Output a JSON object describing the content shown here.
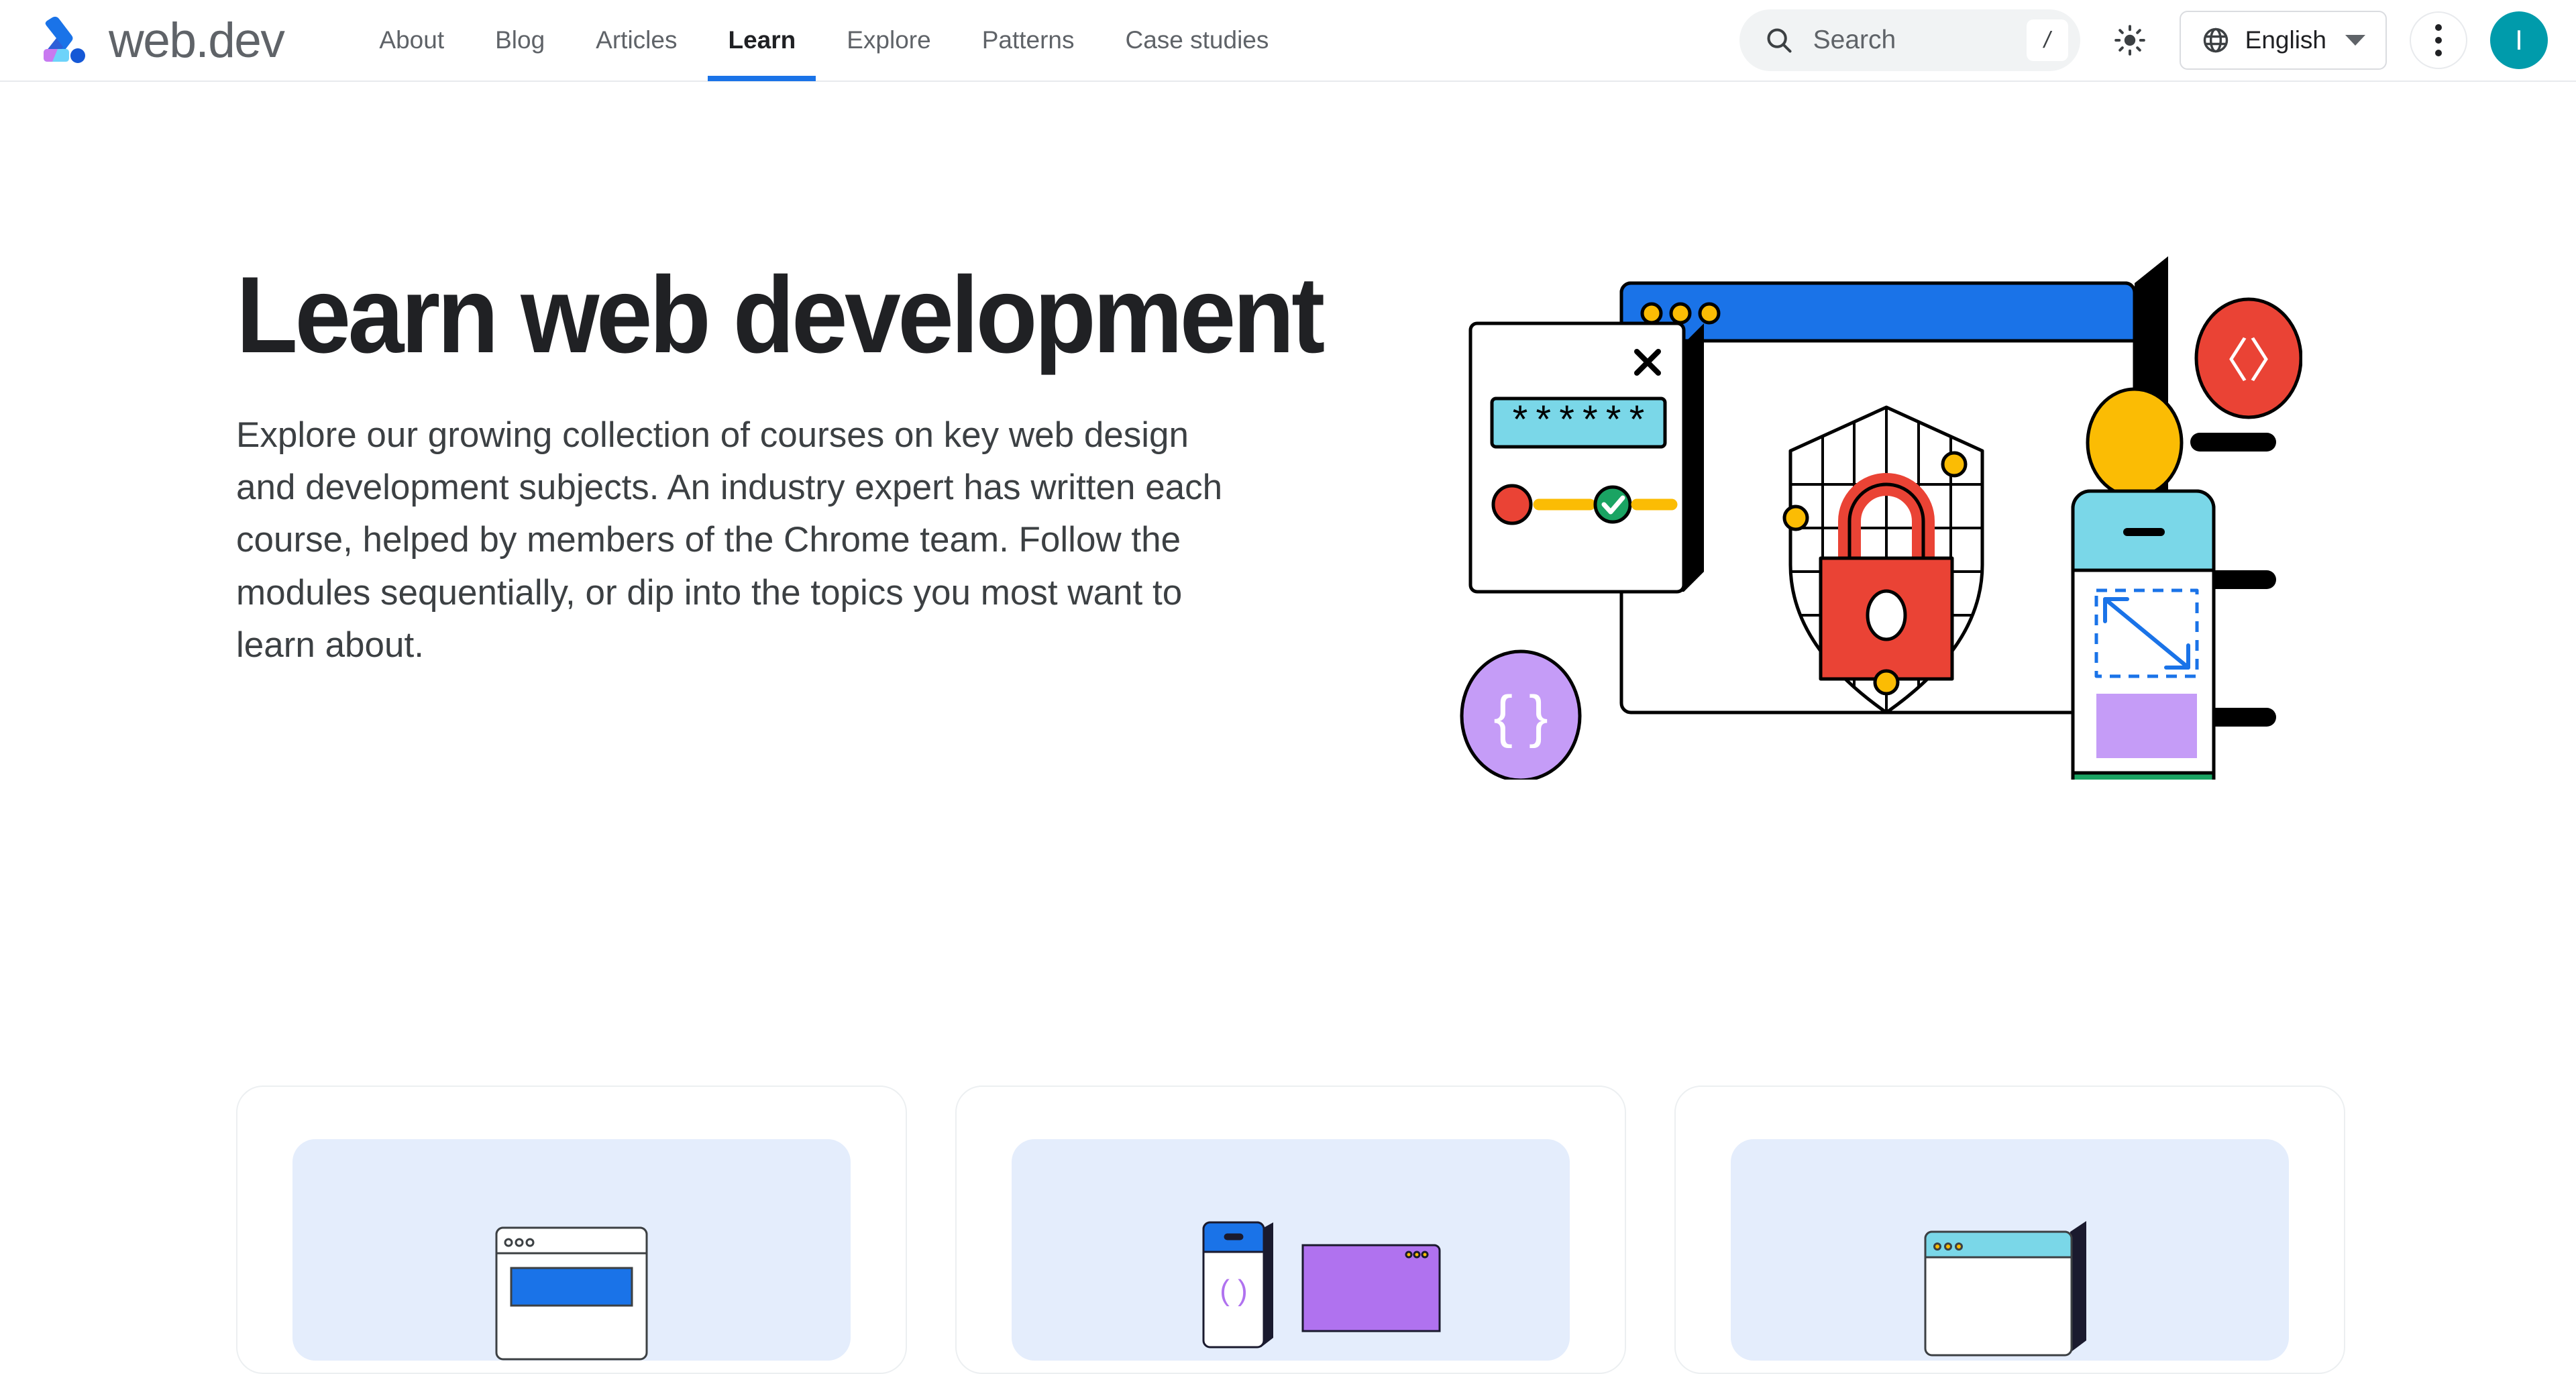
{
  "header": {
    "brand": {
      "name": "web.dev",
      "logo_icon": "webdev-logo-icon"
    },
    "nav": [
      {
        "label": "About",
        "active": false
      },
      {
        "label": "Blog",
        "active": false
      },
      {
        "label": "Articles",
        "active": false
      },
      {
        "label": "Learn",
        "active": true
      },
      {
        "label": "Explore",
        "active": false
      },
      {
        "label": "Patterns",
        "active": false
      },
      {
        "label": "Case studies",
        "active": false
      }
    ],
    "search": {
      "placeholder": "Search",
      "value": "",
      "shortcut": "/",
      "icon": "search-icon"
    },
    "theme_toggle": {
      "icon": "sun-icon",
      "label": "Light theme"
    },
    "language": {
      "label": "English",
      "icon": "globe-icon",
      "caret": "chevron-down-icon"
    },
    "more_menu": {
      "icon": "three-dots-vertical-icon",
      "label": "More"
    },
    "avatar": {
      "initial": "I"
    }
  },
  "hero": {
    "title": "Learn web development",
    "description": "Explore our growing collection of courses on key web design and development subjects. An industry expert has written each course, helped by members of the Chrome team. Follow the modules sequentially, or dip into the topics you most want to learn about.",
    "illustration": "learn-web-development-illustration"
  },
  "cards": [
    {
      "thumb_icon": "browser-window-blue-illustration"
    },
    {
      "thumb_icon": "phone-and-purple-browser-illustration"
    },
    {
      "thumb_icon": "browser-window-cyan-illustration"
    }
  ],
  "colors": {
    "accent_blue": "#1a73e8",
    "text_primary": "#202124",
    "text_secondary": "#5f6368",
    "avatar_teal": "#009bab",
    "search_bg": "#f1f3f4",
    "card_thumb_bg": "#e4edfc",
    "border": "#e8eaed"
  }
}
